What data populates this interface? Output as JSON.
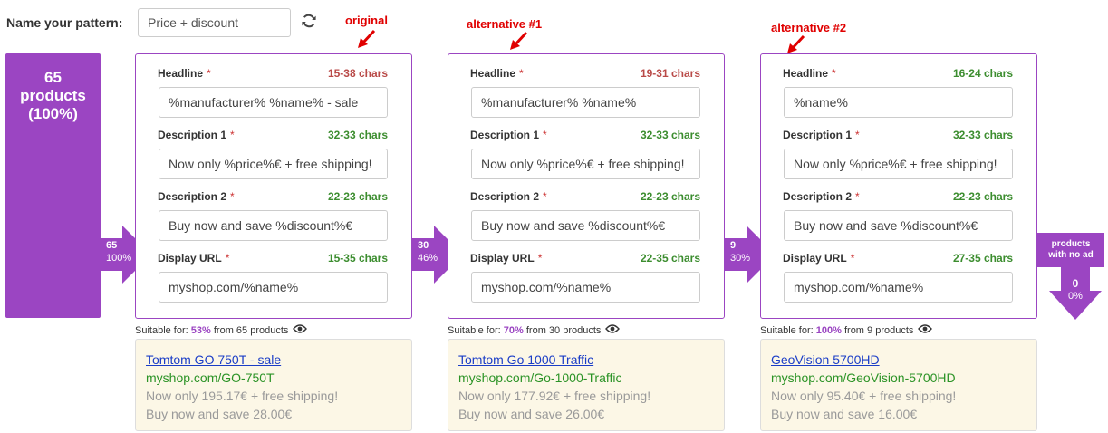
{
  "header": {
    "name_label": "Name your pattern:",
    "name_value": "Price + discount"
  },
  "products": {
    "count": "65",
    "label": "products",
    "percent": "(100%)"
  },
  "colors": {
    "accent": "#9b45c2",
    "required": "#cc3333",
    "chars_red": "#b94a48",
    "chars_green": "#3c8d2f",
    "annotation": "#e00000",
    "preview_bg": "#fcf7e6",
    "link": "#1a3dc7",
    "url": "#2b9326"
  },
  "patterns": [
    {
      "version_label": "original",
      "flow": {
        "count": "65",
        "percent": "100%"
      },
      "headline": {
        "label": "Headline",
        "chars": "15-38 chars",
        "chars_status": "red",
        "value": "%manufacturer% %name% - sale"
      },
      "desc1": {
        "label": "Description 1",
        "chars": "32-33 chars",
        "chars_status": "green",
        "value": "Now only %price%€ + free shipping!"
      },
      "desc2": {
        "label": "Description 2",
        "chars": "22-23 chars",
        "chars_status": "green",
        "value": "Buy now and save %discount%€"
      },
      "url": {
        "label": "Display URL",
        "chars": "15-35 chars",
        "chars_status": "green",
        "value": "myshop.com/%name%"
      },
      "suitable": {
        "prefix": "Suitable for:",
        "percent": "53%",
        "suffix": "from 65 products"
      },
      "preview": {
        "title": "Tomtom GO 750T - sale",
        "url": "myshop.com/GO-750T",
        "desc1": "Now only 195.17€ + free shipping!",
        "desc2": "Buy now and save 28.00€"
      }
    },
    {
      "version_label": "alternative #1",
      "flow": {
        "count": "30",
        "percent": "46%"
      },
      "headline": {
        "label": "Headline",
        "chars": "19-31 chars",
        "chars_status": "red",
        "value": "%manufacturer% %name%"
      },
      "desc1": {
        "label": "Description 1",
        "chars": "32-33 chars",
        "chars_status": "green",
        "value": "Now only %price%€ + free shipping!"
      },
      "desc2": {
        "label": "Description 2",
        "chars": "22-23 chars",
        "chars_status": "green",
        "value": "Buy now and save %discount%€"
      },
      "url": {
        "label": "Display URL",
        "chars": "22-35 chars",
        "chars_status": "green",
        "value": "myshop.com/%name%"
      },
      "suitable": {
        "prefix": "Suitable for:",
        "percent": "70%",
        "suffix": "from 30 products"
      },
      "preview": {
        "title": "Tomtom Go 1000 Traffic",
        "url": "myshop.com/Go-1000-Traffic",
        "desc1": "Now only 177.92€ + free shipping!",
        "desc2": "Buy now and save 26.00€"
      }
    },
    {
      "version_label": "alternative #2",
      "flow": {
        "count": "9",
        "percent": "30%"
      },
      "headline": {
        "label": "Headline",
        "chars": "16-24 chars",
        "chars_status": "green",
        "value": "%name%"
      },
      "desc1": {
        "label": "Description 1",
        "chars": "32-33 chars",
        "chars_status": "green",
        "value": "Now only %price%€ + free shipping!"
      },
      "desc2": {
        "label": "Description 2",
        "chars": "22-23 chars",
        "chars_status": "green",
        "value": "Buy now and save %discount%€"
      },
      "url": {
        "label": "Display URL",
        "chars": "27-35 chars",
        "chars_status": "green",
        "value": "myshop.com/%name%"
      },
      "suitable": {
        "prefix": "Suitable for:",
        "percent": "100%",
        "suffix": "from 9 products"
      },
      "preview": {
        "title": "GeoVision 5700HD",
        "url": "myshop.com/GeoVision-5700HD",
        "desc1": "Now only 95.40€ + free shipping!",
        "desc2": "Buy now and save 16.00€"
      }
    }
  ],
  "no_ad": {
    "label_line1": "products",
    "label_line2": "with no ad",
    "count": "0",
    "percent": "0%"
  },
  "required_marker": "*",
  "icons": {
    "refresh": "refresh-icon",
    "eye": "eye-icon",
    "annotation_arrow": "red-arrow-icon",
    "flow_arrow": "flow-arrow-icon"
  }
}
